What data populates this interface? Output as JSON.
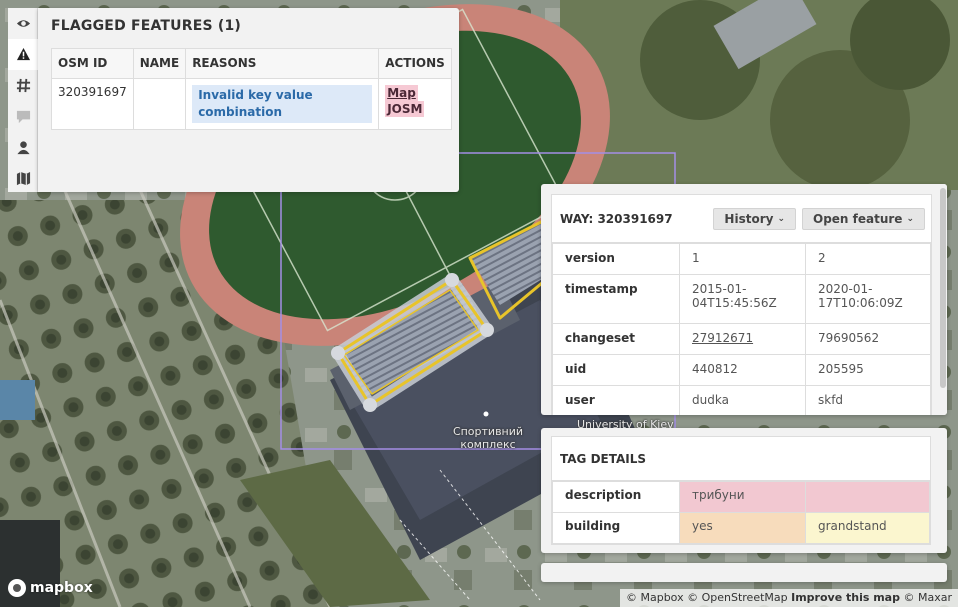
{
  "map": {
    "place_label": "Спортивний комплекс",
    "partial_label": "University of Kiev"
  },
  "toolbar": {
    "items": [
      {
        "icon": "eye-icon",
        "active": false
      },
      {
        "icon": "warning-icon",
        "active": true
      },
      {
        "icon": "hash-icon",
        "active": false
      },
      {
        "icon": "comment-icon",
        "active": false
      },
      {
        "icon": "user-icon",
        "active": false
      },
      {
        "icon": "map-icon",
        "active": false
      }
    ]
  },
  "flagged": {
    "title": "FLAGGED FEATURES (1)",
    "columns": [
      "OSM ID",
      "NAME",
      "REASONS",
      "ACTIONS"
    ],
    "row": {
      "osm_id": "320391697",
      "name": "",
      "reason": "Invalid key value combination",
      "actions": [
        "Map",
        "JOSM"
      ]
    }
  },
  "way": {
    "title": "WAY: 320391697",
    "history_label": "History",
    "open_label": "Open feature",
    "rows": [
      {
        "key": "version",
        "v1": "1",
        "v2": "2"
      },
      {
        "key": "timestamp",
        "v1": "2015-01-04T15:45:56Z",
        "v2": "2020-01-17T10:06:09Z"
      },
      {
        "key": "changeset",
        "v1": "27912671",
        "v2": "79690562"
      },
      {
        "key": "uid",
        "v1": "440812",
        "v2": "205595"
      },
      {
        "key": "user",
        "v1": "dudka",
        "v2": "skfd"
      }
    ]
  },
  "tags": {
    "title": "TAG DETAILS",
    "rows": [
      {
        "key": "description",
        "old": "трибуни",
        "new": ""
      },
      {
        "key": "building",
        "old": "yes",
        "new": "grandstand"
      }
    ]
  },
  "attribution": {
    "mapbox": "© Mapbox",
    "osm": "© OpenStreetMap",
    "improve": "Improve this map",
    "maxar": "© Maxar"
  },
  "logo": "mapbox",
  "colors": {
    "selection": "#e8c42a",
    "bbox": "#a48ee6",
    "track": "#c98478"
  }
}
